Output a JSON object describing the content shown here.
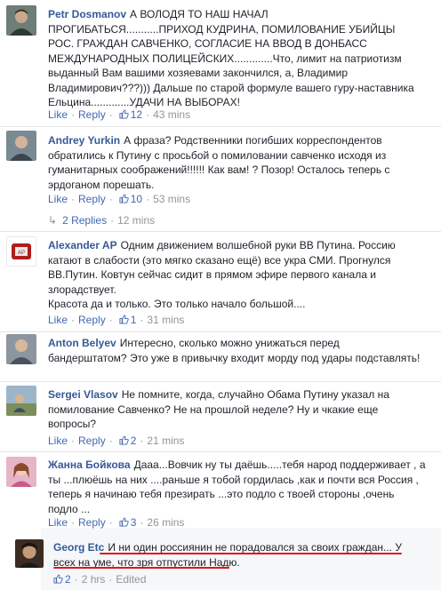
{
  "thread": {
    "like_label": "Like",
    "reply_label": "Reply",
    "edited_label": "Edited",
    "replies_link": "2 Replies",
    "replies_time": "12 mins"
  },
  "comments": [
    {
      "author": "Petr Dosmanov",
      "text": "А ВОЛОДЯ ТО НАШ НАЧАЛ\nПРОГИБАТЬСЯ...........ПРИХОД КУДРИНА, ПОМИЛОВАНИЕ УБИЙЦЫ\nРОС. ГРАЖДАН САВЧЕНКО, СОГЛАСИЕ НА ВВОД В ДОНБАСС\nМЕЖДУНАРОДНЫХ ПОЛИЦЕЙСКИХ.............Что, лимит на патриотизм\nвыданный Вам вашими хозяевами закончился, а, Владимир\nВладимирович???))) Дальше по старой формуле вашего гуру-наставника\nЕльцина.............УДАЧИ НА ВЫБОРАХ!",
      "likes": "12",
      "time": "43 mins"
    },
    {
      "author": "Andrey Yurkin",
      "text": "А фраза? Родственники погибших корреспондентов\nобратились к Путину с просьбой о помиловании савченко исходя из\nгуманитарных соображений!!!!!! Как вам! ? Позор! Осталось теперь с\nэрдоганом порешать.",
      "likes": "10",
      "time": "53 mins"
    },
    {
      "author": "Alexander AP",
      "text": "Одним движением волшебной руки ВВ Путина. Россию\nкатают в слабости (это мягко сказано ещё) все укра СМИ. Прогнулся\nВВ.Путин. Ковтун сейчас сидит в прямом эфире первого канала и\nзлорадствует.\nКрасота да и только. Это только начало большой....",
      "likes": "1",
      "time": "31 mins"
    },
    {
      "author": "Anton Belyev",
      "text": "Интересно, сколько можно унижаться перед\nбандерштатом? Это уже в привычку входит морду под удары подставлять!",
      "likes": "",
      "time": ""
    },
    {
      "author": "Sergei Vlasov",
      "text": "Не помните, когда, случайно Обама Путину указал на\nпомилование Савченко? Не на прошлой неделе? Ну и чкакие еще\nвопросы?",
      "likes": "2",
      "time": "21 mins"
    },
    {
      "author": "Жанна Бойкова",
      "text": "Дааа...Вовчик ну ты даёшь.....тебя народ поддерживает , а\nты ...плюёшь на них ....раньше я тобой гордилась ,как и почти вся Россия ,\nтеперь я начинаю тебя презирать ...это подло с твоей стороны ,очень\nподло ...",
      "likes": "3",
      "time": "26 mins"
    },
    {
      "author": "Georg Etc",
      "text": "И ни один россиянин не порадовался за своих граждан... У\nвсех на уме, что зря отпустили Надю.",
      "likes": "2",
      "time": "2 hrs"
    }
  ],
  "colors": {
    "author": "#365899",
    "link": "#4267b2",
    "meta": "#90949c",
    "underline": "#e0161b"
  }
}
